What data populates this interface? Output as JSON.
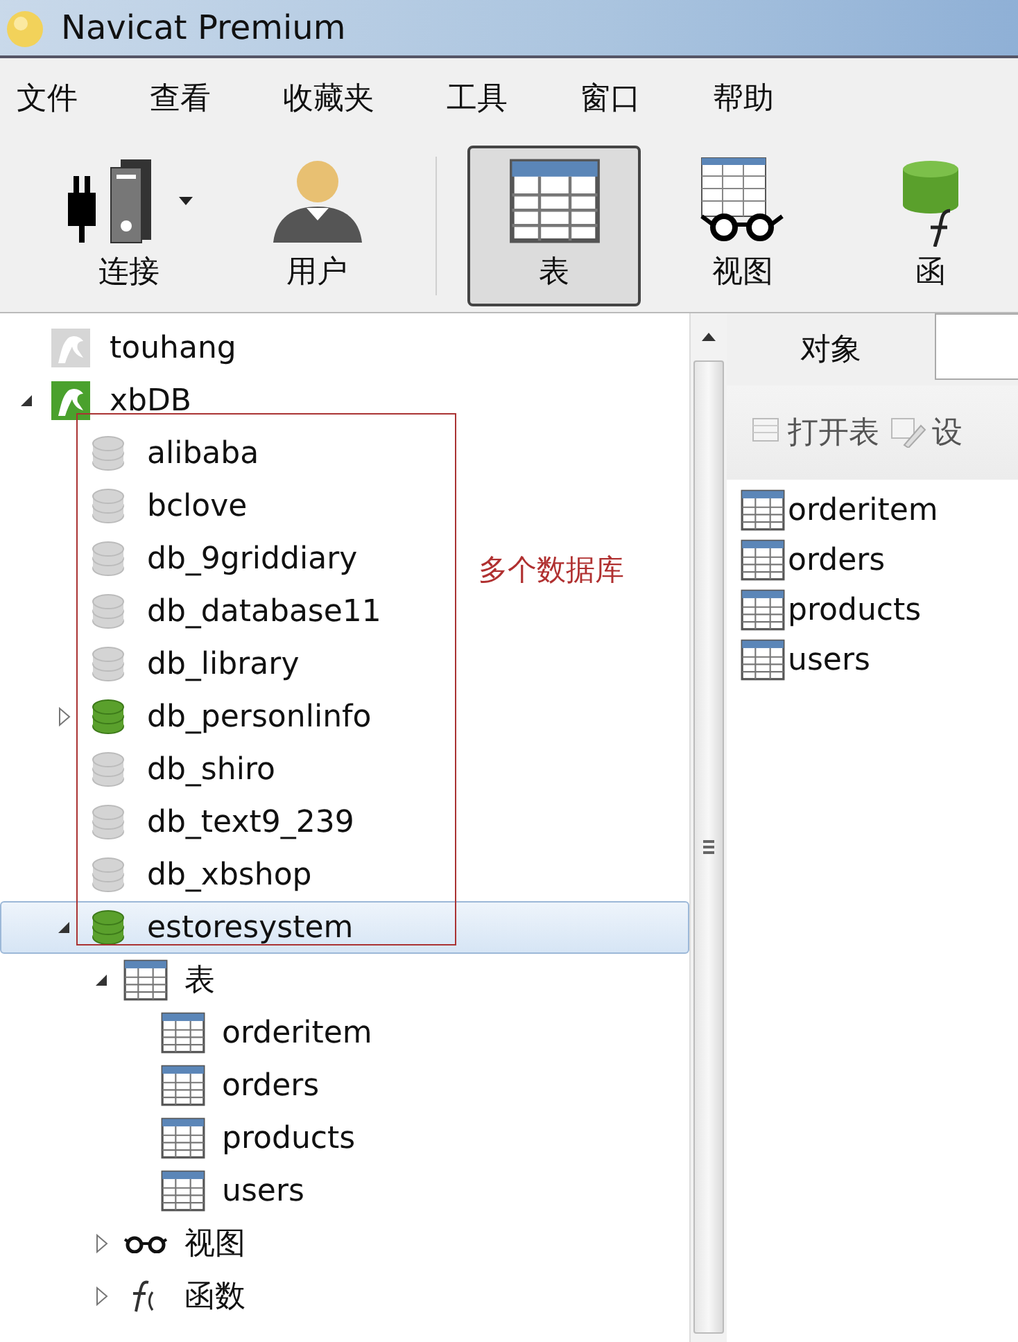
{
  "window": {
    "title": "Navicat Premium"
  },
  "menu": [
    "文件",
    "查看",
    "收藏夹",
    "工具",
    "窗口",
    "帮助"
  ],
  "toolbar": [
    {
      "label": "连接",
      "kind": "connect",
      "selected": false,
      "dropdown": true
    },
    {
      "label": "用户",
      "kind": "user",
      "selected": false,
      "dropdown": false
    },
    {
      "label": "表",
      "kind": "table",
      "selected": true,
      "dropdown": false
    },
    {
      "label": "视图",
      "kind": "view",
      "selected": false,
      "dropdown": false
    },
    {
      "label": "函",
      "kind": "function",
      "selected": false,
      "dropdown": false
    }
  ],
  "tree": [
    {
      "name": "touhang",
      "kind": "connection",
      "open": false,
      "selected": false
    },
    {
      "name": "xbDB",
      "kind": "connection",
      "open": true,
      "selected": false,
      "expanded": true,
      "children": [
        {
          "name": "alibaba",
          "kind": "database",
          "open": false,
          "selected": false
        },
        {
          "name": "bclove",
          "kind": "database",
          "open": false,
          "selected": false
        },
        {
          "name": "db_9griddiary",
          "kind": "database",
          "open": false,
          "selected": false
        },
        {
          "name": "db_database11",
          "kind": "database",
          "open": false,
          "selected": false
        },
        {
          "name": "db_library",
          "kind": "database",
          "open": false,
          "selected": false
        },
        {
          "name": "db_personlinfo",
          "kind": "database",
          "open": true,
          "selected": false,
          "expanded": false
        },
        {
          "name": "db_shiro",
          "kind": "database",
          "open": false,
          "selected": false
        },
        {
          "name": "db_text9_239",
          "kind": "database",
          "open": false,
          "selected": false
        },
        {
          "name": "db_xbshop",
          "kind": "database",
          "open": false,
          "selected": false
        },
        {
          "name": "estoresystem",
          "kind": "database",
          "open": true,
          "selected": true,
          "expanded": true,
          "children": [
            {
              "name": "表",
              "kind": "tables",
              "selected": false,
              "expanded": true,
              "children": [
                {
                  "name": "orderitem",
                  "kind": "table",
                  "selected": false
                },
                {
                  "name": "orders",
                  "kind": "table",
                  "selected": false
                },
                {
                  "name": "products",
                  "kind": "table",
                  "selected": false
                },
                {
                  "name": "users",
                  "kind": "table",
                  "selected": false
                }
              ]
            },
            {
              "name": "视图",
              "kind": "views",
              "selected": false,
              "expanded": false
            },
            {
              "name": "函数",
              "kind": "functions",
              "selected": false,
              "expanded": false
            }
          ]
        }
      ]
    }
  ],
  "annotation": {
    "label": "多个数据库"
  },
  "objects_panel": {
    "tab": "对象",
    "actions": [
      "打开表",
      "设"
    ],
    "items": [
      "orderitem",
      "orders",
      "products",
      "users"
    ]
  }
}
